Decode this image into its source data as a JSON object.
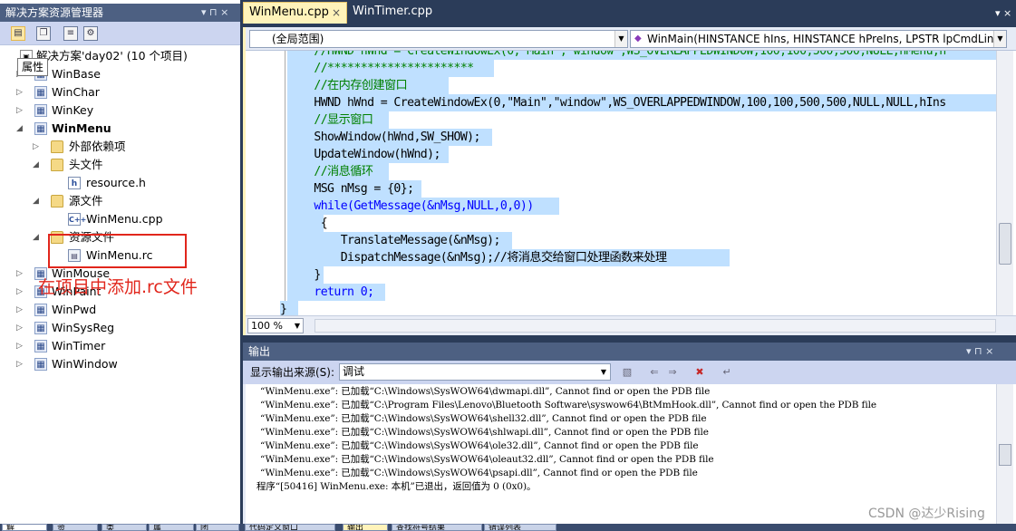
{
  "solution_explorer": {
    "title": "解决方案资源管理器",
    "title_controls": "▾ ⊓ ×",
    "toolbar_icons": [
      "properties-icon",
      "show-all-files-icon",
      "refresh-icon",
      "view-class-icon"
    ],
    "tooltip": "属性",
    "solution": "解决方案'day02' (10 个项目)",
    "projects": [
      "WinBase",
      "WinChar",
      "WinKey",
      "WinMenu",
      "WinMouse",
      "WinPaint",
      "WinPwd",
      "WinSysReg",
      "WinTimer",
      "WinWindow"
    ],
    "winmenu_children": {
      "external": "外部依赖项",
      "headers": "头文件",
      "header_file": "resource.h",
      "sources": "源文件",
      "source_file": "WinMenu.cpp",
      "resources": "资源文件",
      "resource_file": "WinMenu.rc"
    },
    "annotation": "在项目中添加.rc文件"
  },
  "editor": {
    "tabs": [
      "WinMenu.cpp",
      "WinTimer.cpp"
    ],
    "scope_dropdown": "(全局范围)",
    "function_dropdown": "WinMain(HINSTANCE hIns, HINSTANCE hPreIns, LPSTR lpCmdLine",
    "zoom": "100 %",
    "code_lines": [
      "    //HWND hWnd = CreateWindowEx(0,\"Main\",\"window\",WS_OVERLAPPEDWINDOW,100,100,500,500,NULL,hMenu,h",
      "    //**********************",
      "    //在内存创建窗口",
      "    HWND hWnd = CreateWindowEx(0,\"Main\",\"window\",WS_OVERLAPPEDWINDOW,100,100,500,500,NULL,NULL,hIns",
      "    //显示窗口",
      "    ShowWindow(hWnd,SW_SHOW);",
      "    UpdateWindow(hWnd);",
      "    //消息循环",
      "    MSG nMsg = {0};",
      "    while(GetMessage(&nMsg,NULL,0,0))",
      "     {",
      "        TranslateMessage(&nMsg);",
      "        DispatchMessage(&nMsg);//将消息交给窗口处理函数来处理",
      "    }",
      "    return 0;",
      "}"
    ]
  },
  "output": {
    "title": "输出",
    "title_controls": "▾ ⊓ ×",
    "source_label": "显示输出来源(S):",
    "source_value": "调试",
    "lines": [
      "“WinMenu.exe”: 已加载“C:\\Windows\\SysWOW64\\dwmapi.dll”, Cannot find or open the PDB file",
      "“WinMenu.exe”: 已加载“C:\\Program Files\\Lenovo\\Bluetooth Software\\syswow64\\BtMmHook.dll”, Cannot find or open the PDB file",
      "“WinMenu.exe”: 已加载“C:\\Windows\\SysWOW64\\shell32.dll”, Cannot find or open the PDB file",
      "“WinMenu.exe”: 已加载“C:\\Windows\\SysWOW64\\shlwapi.dll”, Cannot find or open the PDB file",
      "“WinMenu.exe”: 已加载“C:\\Windows\\SysWOW64\\ole32.dll”, Cannot find or open the PDB file",
      "“WinMenu.exe”: 已加载“C:\\Windows\\SysWOW64\\oleaut32.dll”, Cannot find or open the PDB file",
      "“WinMenu.exe”: 已加载“C:\\Windows\\SysWOW64\\psapi.dll”, Cannot find or open the PDB file",
      "程序“[50416] WinMenu.exe: 本机”已退出，返回值为 0 (0x0)。"
    ]
  },
  "bottom_tabs": [
    "解",
    "资",
    "类",
    "属",
    "团",
    "代码定义窗口",
    "输出",
    "查找符号结果",
    "错误列表"
  ],
  "watermark": "CSDN @达少Rising",
  "colors": {
    "title_bar": "#4d6082",
    "active_tab": "#fff3ba",
    "selection": "#bfe0ff",
    "annotation": "#e1261c",
    "keyword": "#0000ff",
    "comment": "#008000",
    "string": "#a31515"
  }
}
